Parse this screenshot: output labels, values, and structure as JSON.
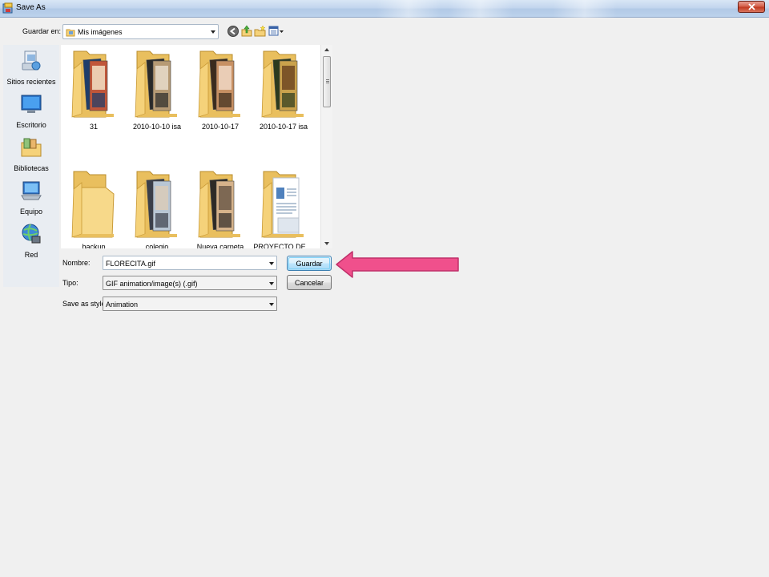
{
  "window": {
    "title": "Save As",
    "close_symbol": "✕"
  },
  "toolbar": {
    "save_in_label": "Guardar en:",
    "save_in_value": "Mis imágenes",
    "icons": [
      "back-icon",
      "up-folder-icon",
      "new-folder-icon",
      "view-menu-icon"
    ]
  },
  "places": [
    {
      "label": "Sitios recientes",
      "icon": "recent-places-icon"
    },
    {
      "label": "Escritorio",
      "icon": "desktop-icon"
    },
    {
      "label": "Bibliotecas",
      "icon": "libraries-icon"
    },
    {
      "label": "Equipo",
      "icon": "computer-icon"
    },
    {
      "label": "Red",
      "icon": "network-icon"
    }
  ],
  "files": [
    {
      "name": "31"
    },
    {
      "name": "2010-10-10 isa"
    },
    {
      "name": "2010-10-17"
    },
    {
      "name": "2010-10-17 isa"
    },
    {
      "name": "backup"
    },
    {
      "name": "colegio"
    },
    {
      "name": "Nueva carpeta"
    },
    {
      "name": "PROYECTO DE ..."
    }
  ],
  "form": {
    "name_label": "Nombre:",
    "name_value": "FLORECITA.gif",
    "type_label": "Tipo:",
    "type_value": "GIF animation/image(s) (.gif)",
    "style_label": "Save as style:",
    "style_value": "Animation"
  },
  "buttons": {
    "save": "Guardar",
    "cancel": "Cancelar"
  },
  "colors": {
    "annotation_arrow": "#f0508c",
    "folder": "#f5d27a"
  }
}
